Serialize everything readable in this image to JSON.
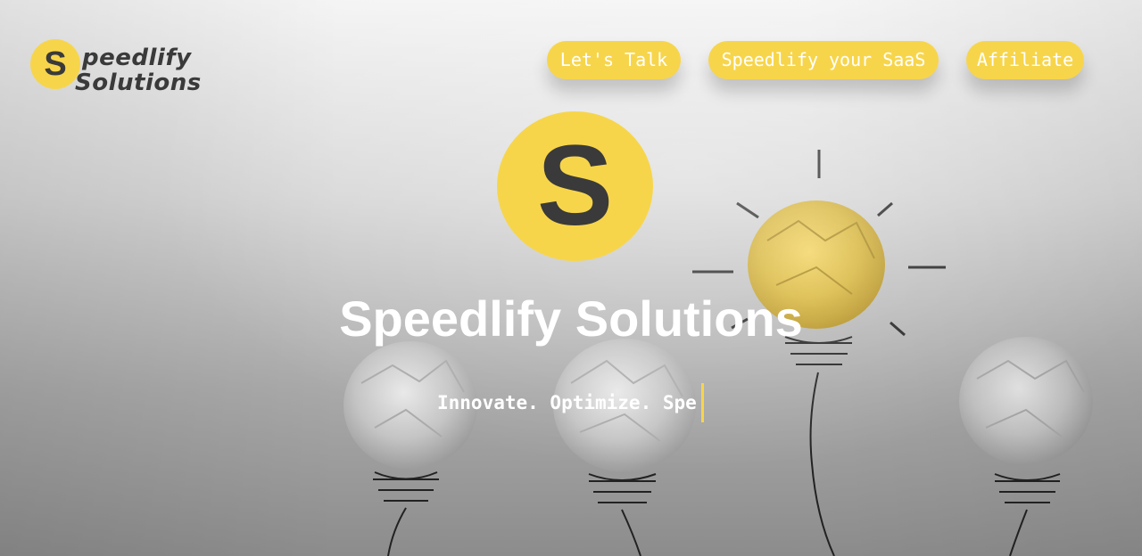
{
  "brand": {
    "logo_letter": "S",
    "logo_line1": "peedlify",
    "logo_line2": "Solutions",
    "accent_color": "#f7d54b",
    "text_color": "#3a3a3a"
  },
  "nav": [
    {
      "label": "Let's Talk"
    },
    {
      "label": "Speedlify your SaaS"
    },
    {
      "label": "Affiliate"
    }
  ],
  "hero": {
    "emblem_letter": "S",
    "title": "Speedlify Solutions",
    "tagline_typed": "Innovate. Optimize. Spe"
  }
}
